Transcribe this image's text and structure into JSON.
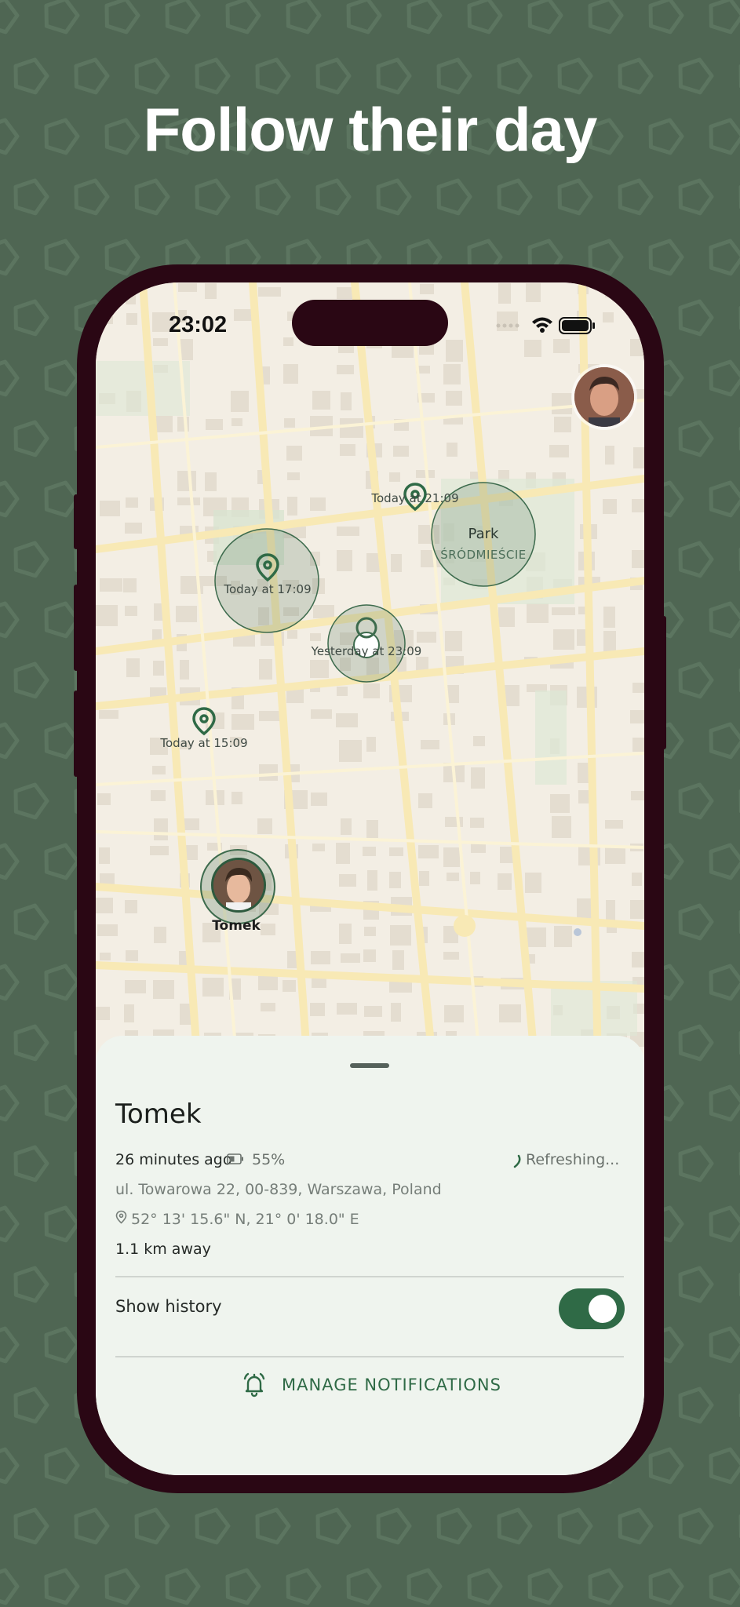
{
  "headline": "Follow their day",
  "status_bar": {
    "time": "23:02"
  },
  "map": {
    "markers": [
      {
        "label": "Today at 21:09"
      },
      {
        "label": "Today at 17:09"
      },
      {
        "label": "Yesterday at 23:09"
      },
      {
        "label": "Today at 15:09"
      }
    ],
    "park": {
      "name": "Park",
      "district": "ŚRÓDMIEŚCIE"
    },
    "person_name": "Tomek"
  },
  "sheet": {
    "name": "Tomek",
    "last_seen": "26 minutes ago",
    "battery": "55%",
    "refresh_status": "Refreshing...",
    "address": "ul. Towarowa 22, 00-839, Warszawa, Poland",
    "coordinates": "52° 13' 15.6\" N, 21° 0' 18.0\" E",
    "distance": "1.1 km away",
    "history_label": "Show history",
    "history_enabled": true,
    "notifications_button": "MANAGE NOTIFICATIONS"
  },
  "colors": {
    "background": "#4f6653",
    "phone_frame": "#2a0714",
    "accent": "#2f6a46",
    "sheet": "#eff4ee"
  }
}
